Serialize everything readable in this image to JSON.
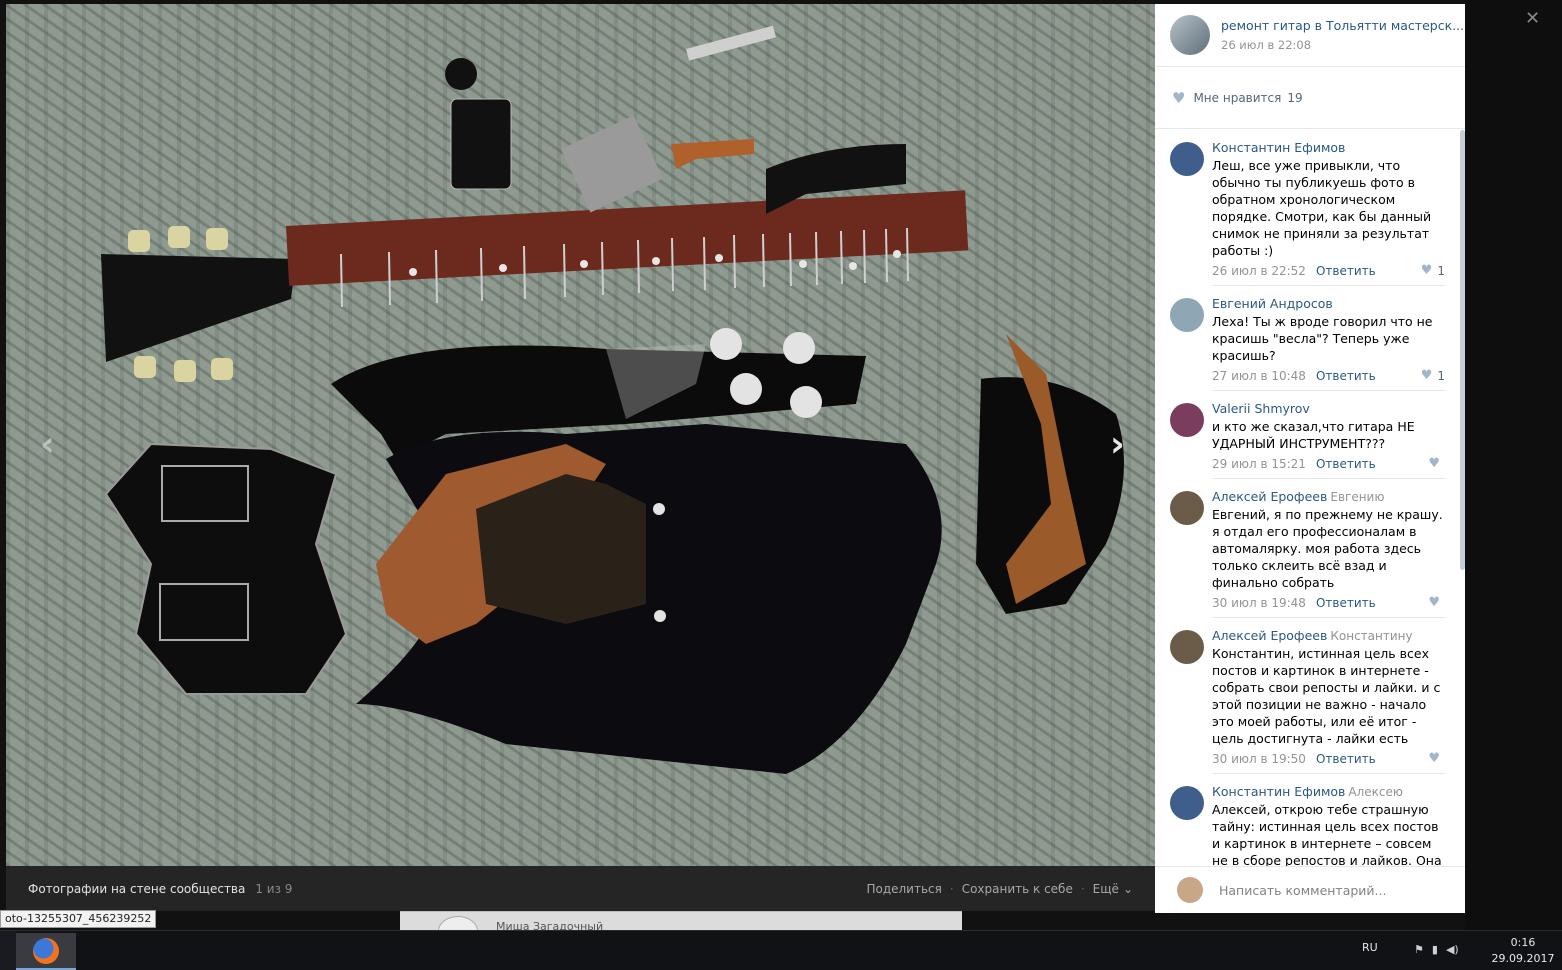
{
  "viewer": {
    "album_title": "Фотографии на стене сообщества",
    "counter": "1 из 9",
    "actions": {
      "share": "Поделиться",
      "save": "Сохранить к себе",
      "more": "Ещё"
    },
    "prev_icon": "chevron-left-icon",
    "next_icon": "chevron-right-icon"
  },
  "below": {
    "text": "Миша Загадочный"
  },
  "url_tip": "oto-13255307_456239252",
  "post": {
    "author": "ремонт гитар в Тольятти мастерск...",
    "date": "26 июл в 22:08",
    "likes_label": "Мне нравится",
    "likes_count": "19"
  },
  "comments": [
    {
      "author": "Константин Ефимов",
      "reply_to": "",
      "text": "Леш, все уже привыкли, что обычно ты публикуешь фото в обратном хронологическом порядке. Смотри, как бы данный снимок не приняли за результат работы :)",
      "date": "26 июл в 22:52",
      "reply": "Ответить",
      "likes": "1",
      "avatar_color": "#3f5e8c"
    },
    {
      "author": "Евгений Андросов",
      "reply_to": "",
      "text": "Леха! Ты ж вроде говорил что не красишь \"весла\"? Теперь уже красишь?",
      "date": "27 июл в 10:48",
      "reply": "Ответить",
      "likes": "1",
      "avatar_color": "#8fa7b5"
    },
    {
      "author": "Valerii Shmyrov",
      "reply_to": "",
      "text": "и кто же сказал,что гитара НЕ УДАРНЫЙ ИНСТРУМЕНТ???",
      "date": "29 июл в 15:21",
      "reply": "Ответить",
      "likes": "",
      "avatar_color": "#7a3d5e"
    },
    {
      "author": "Алексей Ерофеев",
      "reply_to": "Евгению",
      "text": "Евгений, я по прежнему не крашу. я отдал его профессионалам в автомалярку. моя работа здесь только склеить всё взад и финально собрать",
      "date": "30 июл в 19:48",
      "reply": "Ответить",
      "likes": "",
      "avatar_color": "#6b5c4a"
    },
    {
      "author": "Алексей Ерофеев",
      "reply_to": "Константину",
      "text": "Константин, истинная цель всех постов и картинок в интернете - собрать свои репосты и лайки. и с этой позиции не важно - начало это моей работы, или её итог - цель достигнута - лайки есть",
      "date": "30 июл в 19:50",
      "reply": "Ответить",
      "likes": "",
      "avatar_color": "#6b5c4a"
    },
    {
      "author": "Константин Ефимов",
      "reply_to": "Алексею",
      "text": "Алексей, открою тебе страшную тайну: истинная цель всех постов и картинок в интернете – совсем не в сборе репостов и лайков. Она",
      "date": "",
      "reply": "",
      "likes": "",
      "avatar_color": "#3f5e8c"
    }
  ],
  "comment_input": {
    "placeholder": "Написать комментарий..."
  },
  "taskbar": {
    "lang": "RU",
    "time": "0:16",
    "date": "29.09.2017"
  },
  "colors": {
    "link": "#2a5885",
    "muted": "#939393",
    "viewer_bar": "#252525"
  }
}
